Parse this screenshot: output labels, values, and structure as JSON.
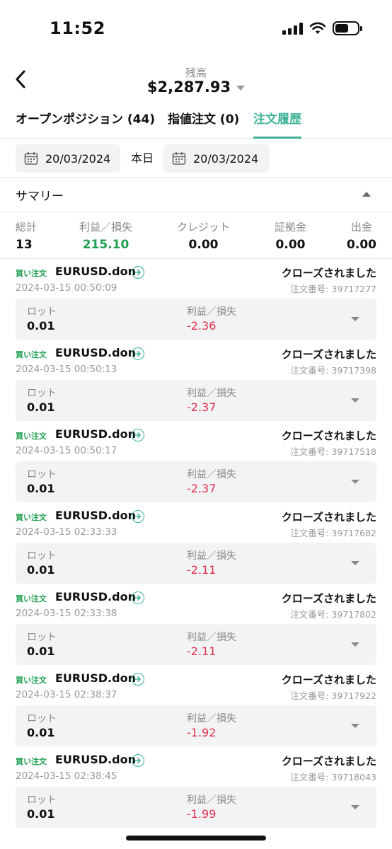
{
  "status_bar": {
    "time": "11:52"
  },
  "header": {
    "balance_label": "残高",
    "balance_value": "$2,287.93"
  },
  "tabs": [
    {
      "label": "オープンポジション (44)",
      "active": false
    },
    {
      "label": "指値注文 (0)",
      "active": false
    },
    {
      "label": "注文履歴",
      "active": true
    }
  ],
  "date_filter": {
    "from": "20/03/2024",
    "separator": "本日",
    "to": "20/03/2024"
  },
  "summary": {
    "title": "サマリー",
    "stats": [
      {
        "label": "総計",
        "value": "13"
      },
      {
        "label": "利益／損失",
        "value": "215.10"
      },
      {
        "label": "クレジット",
        "value": "0.00"
      },
      {
        "label": "証拠金",
        "value": "0.00"
      },
      {
        "label": "出金",
        "value": "0.00"
      }
    ]
  },
  "colors": {
    "accent": "#3fb39a",
    "profit": "#20a050",
    "loss": "#e0304a"
  },
  "orders": [
    {
      "type": "買い注文",
      "symbol": "EURUSD.don",
      "status": "クローズされました",
      "time": "2024-03-15 00:50:09",
      "order_no": "注文番号: 39717277",
      "lot_label": "ロット",
      "lot": "0.01",
      "pl_label": "利益／損失",
      "pl": "-2.36"
    },
    {
      "type": "買い注文",
      "symbol": "EURUSD.don",
      "status": "クローズされました",
      "time": "2024-03-15 00:50:13",
      "order_no": "注文番号: 39717398",
      "lot_label": "ロット",
      "lot": "0.01",
      "pl_label": "利益／損失",
      "pl": "-2.37"
    },
    {
      "type": "買い注文",
      "symbol": "EURUSD.don",
      "status": "クローズされました",
      "time": "2024-03-15 00:50:17",
      "order_no": "注文番号: 39717518",
      "lot_label": "ロット",
      "lot": "0.01",
      "pl_label": "利益／損失",
      "pl": "-2.37"
    },
    {
      "type": "買い注文",
      "symbol": "EURUSD.don",
      "status": "クローズされました",
      "time": "2024-03-15 02:33:33",
      "order_no": "注文番号: 39717682",
      "lot_label": "ロット",
      "lot": "0.01",
      "pl_label": "利益／損失",
      "pl": "-2.11"
    },
    {
      "type": "買い注文",
      "symbol": "EURUSD.don",
      "status": "クローズされました",
      "time": "2024-03-15 02:33:38",
      "order_no": "注文番号: 39717802",
      "lot_label": "ロット",
      "lot": "0.01",
      "pl_label": "利益／損失",
      "pl": "-2.11"
    },
    {
      "type": "買い注文",
      "symbol": "EURUSD.don",
      "status": "クローズされました",
      "time": "2024-03-15 02:38:37",
      "order_no": "注文番号: 39717922",
      "lot_label": "ロット",
      "lot": "0.01",
      "pl_label": "利益／損失",
      "pl": "-1.92"
    },
    {
      "type": "買い注文",
      "symbol": "EURUSD.don",
      "status": "クローズされました",
      "time": "2024-03-15 02:38:45",
      "order_no": "注文番号: 39718043",
      "lot_label": "ロット",
      "lot": "0.01",
      "pl_label": "利益／損失",
      "pl": "-1.99"
    }
  ]
}
